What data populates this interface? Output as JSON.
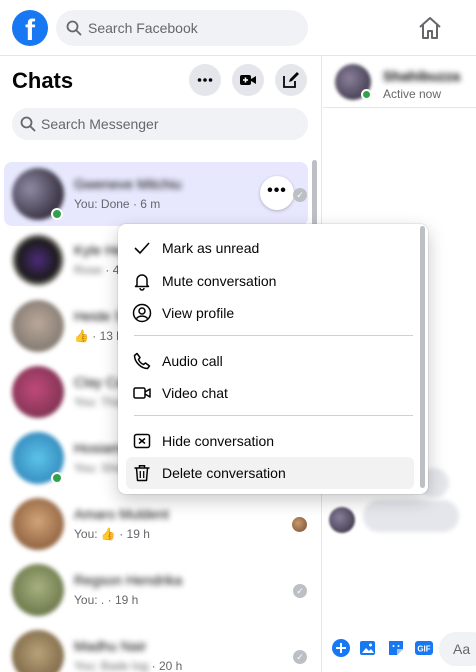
{
  "topbar": {
    "logo_letter": "f",
    "search_placeholder": "Search Facebook"
  },
  "sidebar": {
    "title": "Chats",
    "search_placeholder": "Search Messenger",
    "conversations": [
      {
        "name": "Gweneve Mitchiu",
        "preview": "You: Done",
        "time": "6 m",
        "online": true
      },
      {
        "name": "Kyle Henderson",
        "preview": "Rose",
        "time": "4 h",
        "online": false
      },
      {
        "name": "Heide Sorensen",
        "preview": "👍",
        "time": "13 h",
        "online": false
      },
      {
        "name": "Clay Cavendish",
        "preview": "You: Thanks",
        "time": "",
        "online": false
      },
      {
        "name": "Hosiamo Borewha",
        "preview": "You: She",
        "time": "",
        "online": true
      },
      {
        "name": "Amaro Muldent",
        "preview": "You: 👍",
        "time": "19 h",
        "online": false
      },
      {
        "name": "Regson Hendrika",
        "preview": "You: .",
        "time": "19 h",
        "online": false
      },
      {
        "name": "Madhu Nair",
        "preview": "You: Bade log",
        "time": "20 h",
        "online": false
      }
    ]
  },
  "context_menu": {
    "items": [
      {
        "label": "Mark as unread",
        "icon": "checkmark-icon"
      },
      {
        "label": "Mute conversation",
        "icon": "bell-icon"
      },
      {
        "label": "View profile",
        "icon": "profile-icon"
      },
      {
        "label": "Audio call",
        "icon": "phone-icon"
      },
      {
        "label": "Video chat",
        "icon": "video-camera-icon"
      },
      {
        "label": "Hide conversation",
        "icon": "hide-box-icon"
      },
      {
        "label": "Delete conversation",
        "icon": "trash-icon"
      }
    ]
  },
  "chat_panel": {
    "contact_name": "Shahibuzza",
    "status": "Active now",
    "composer_placeholder": "Aa"
  },
  "colors": {
    "accent": "#1877f2",
    "active_row": "#e7e8fd",
    "online": "#31a24c"
  }
}
